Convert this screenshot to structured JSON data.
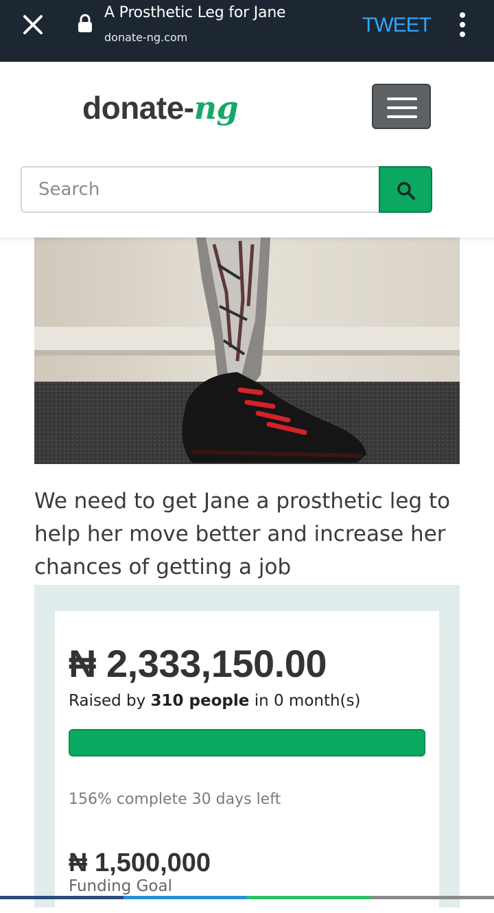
{
  "browser": {
    "title": "A Prosthetic Leg for Jane",
    "url": "donate-ng.com",
    "tweet_label": "TWEET"
  },
  "site": {
    "logo_main": "donate-",
    "logo_accent": "ng",
    "search_placeholder": "Search"
  },
  "campaign": {
    "description": "We need to get Jane a prosthetic leg to help her move better and increase her chances of getting a job",
    "raised_amount": "₦ 2,333,150.00",
    "raised_prefix": "Raised by",
    "donor_count": "310 people",
    "raised_suffix": "in 0 month(s)",
    "progress_fraction": 1.0,
    "percent_complete": "156% complete",
    "days_left": "30 days left",
    "goal_amount": "₦ 1,500,000",
    "goal_label": "Funding Goal"
  },
  "colors": {
    "topbar": "#1d2731",
    "tweet": "#2ea7ff",
    "brand_green": "#0aa860",
    "panel": "#e1ecec"
  },
  "icons": [
    "close-icon",
    "lock-icon",
    "more-vert-icon",
    "menu-icon",
    "search-icon"
  ]
}
